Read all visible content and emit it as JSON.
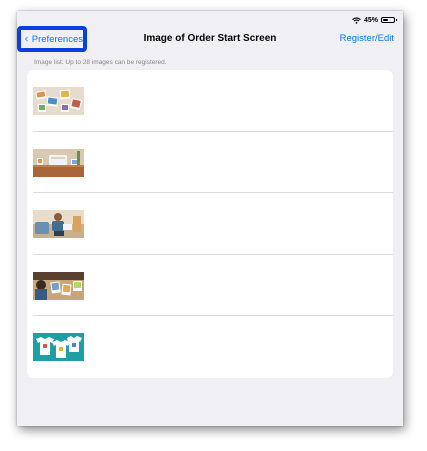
{
  "status_bar": {
    "battery_text": "45%",
    "battery_level": 0.45,
    "icons": [
      "wifi-icon",
      "battery-icon"
    ]
  },
  "nav": {
    "back_label": "Preferences",
    "title": "Image of Order Start Screen",
    "action_label": "Register/Edit",
    "accent_color": "#0a7bff",
    "highlight_color": "#0b3fe0"
  },
  "list": {
    "note": "Image list: Up to 28 images can be registered.",
    "items": [
      {
        "image": "photo-prints-on-table-thumbnail"
      },
      {
        "image": "printer-on-wooden-desk-thumbnail"
      },
      {
        "image": "person-sitting-on-sofa-thumbnail"
      },
      {
        "image": "person-at-desk-with-prints-thumbnail"
      },
      {
        "image": "printed-tshirts-on-teal-thumbnail"
      }
    ]
  }
}
